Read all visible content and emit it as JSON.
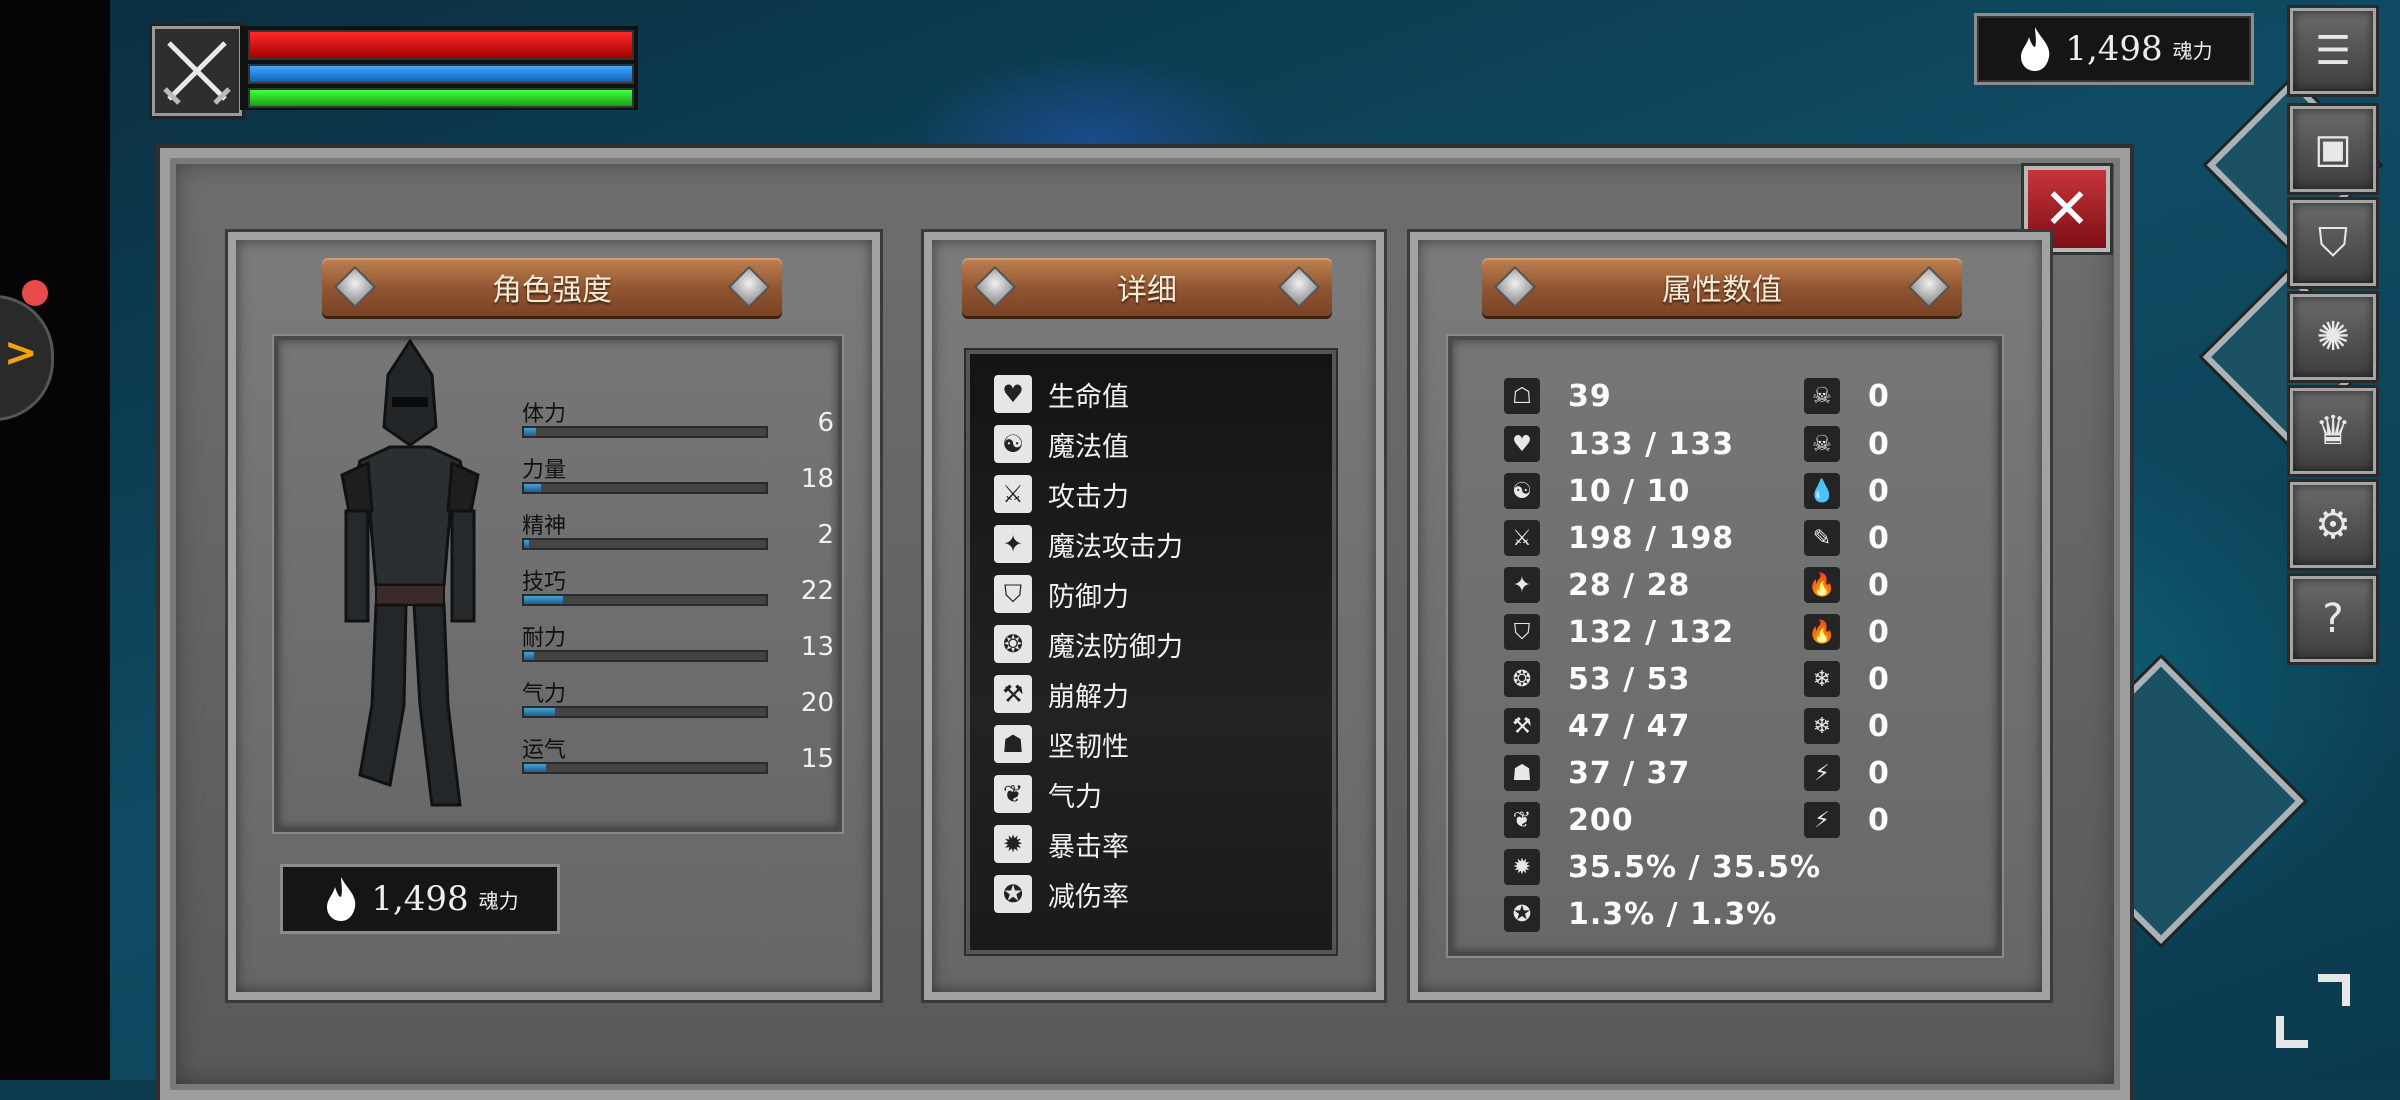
{
  "hud": {
    "soul_power": {
      "value": "1,498",
      "unit": "魂力"
    }
  },
  "menu_buttons": [
    {
      "name": "menu-list-button",
      "glyph": "☰"
    },
    {
      "name": "inventory-button",
      "glyph": "▣"
    },
    {
      "name": "armor-button",
      "glyph": "⛉"
    },
    {
      "name": "skill-button",
      "glyph": "✺"
    },
    {
      "name": "crown-button",
      "glyph": "♛"
    },
    {
      "name": "settings-button",
      "glyph": "⚙"
    },
    {
      "name": "help-button",
      "glyph": "?"
    }
  ],
  "panels": {
    "character": {
      "title": "角色强度",
      "stats": [
        {
          "label": "体力",
          "value": "6",
          "fill": 0.05
        },
        {
          "label": "力量",
          "value": "18",
          "fill": 0.07
        },
        {
          "label": "精神",
          "value": "2",
          "fill": 0.02
        },
        {
          "label": "技巧",
          "value": "22",
          "fill": 0.16
        },
        {
          "label": "耐力",
          "value": "13",
          "fill": 0.04
        },
        {
          "label": "气力",
          "value": "20",
          "fill": 0.13
        },
        {
          "label": "运气",
          "value": "15",
          "fill": 0.09
        }
      ],
      "soul_power": {
        "value": "1,498",
        "unit": "魂力"
      }
    },
    "detail": {
      "title": "详细",
      "rows": [
        {
          "icon": "♥",
          "icon_name": "heart-icon",
          "label": "生命值"
        },
        {
          "icon": "☯",
          "icon_name": "mind-icon",
          "label": "魔法值"
        },
        {
          "icon": "⚔",
          "icon_name": "sword-icon",
          "label": "攻击力"
        },
        {
          "icon": "✦",
          "icon_name": "spellbook-icon",
          "label": "魔法攻击力"
        },
        {
          "icon": "⛉",
          "icon_name": "shield-icon",
          "label": "防御力"
        },
        {
          "icon": "❂",
          "icon_name": "magic-shield-icon",
          "label": "魔法防御力"
        },
        {
          "icon": "⚒",
          "icon_name": "hammer-icon",
          "label": "崩解力"
        },
        {
          "icon": "☗",
          "icon_name": "helmet-icon",
          "label": "坚韧性"
        },
        {
          "icon": "❦",
          "icon_name": "lungs-icon",
          "label": "气力"
        },
        {
          "icon": "✹",
          "icon_name": "critical-icon",
          "label": "暴击率"
        },
        {
          "icon": "✪",
          "icon_name": "damage-reduction-icon",
          "label": "减伤率"
        }
      ]
    },
    "attributes": {
      "title": "属性数值",
      "left": [
        {
          "icon": "☖",
          "icon_name": "armor-weight-icon",
          "value": "39"
        },
        {
          "icon": "♥",
          "icon_name": "heart-icon",
          "value": "133 / 133"
        },
        {
          "icon": "☯",
          "icon_name": "mind-icon",
          "value": "10 / 10"
        },
        {
          "icon": "⚔",
          "icon_name": "sword-icon",
          "value": "198 / 198"
        },
        {
          "icon": "✦",
          "icon_name": "spellbook-icon",
          "value": "28 / 28"
        },
        {
          "icon": "⛉",
          "icon_name": "shield-icon",
          "value": "132 / 132"
        },
        {
          "icon": "❂",
          "icon_name": "magic-shield-icon",
          "value": "53 / 53"
        },
        {
          "icon": "⚒",
          "icon_name": "hammer-icon",
          "value": "47 / 47"
        },
        {
          "icon": "☗",
          "icon_name": "helmet-icon",
          "value": "37 / 37"
        },
        {
          "icon": "❦",
          "icon_name": "lungs-icon",
          "value": "200"
        },
        {
          "icon": "✹",
          "icon_name": "critical-icon",
          "value": "35.5% / 35.5%"
        },
        {
          "icon": "✪",
          "icon_name": "damage-reduction-icon",
          "value": "1.3% / 1.3%"
        }
      ],
      "right": [
        {
          "icon": "☠",
          "icon_name": "poison-icon",
          "value": "0"
        },
        {
          "icon": "☠",
          "icon_name": "poison-resist-icon",
          "value": "0"
        },
        {
          "icon": "💧",
          "icon_name": "bleed-icon",
          "value": "0"
        },
        {
          "icon": "✎",
          "icon_name": "bleed-resist-icon",
          "value": "0"
        },
        {
          "icon": "🔥",
          "icon_name": "fire-icon",
          "value": "0"
        },
        {
          "icon": "🔥",
          "icon_name": "fire-resist-icon",
          "value": "0"
        },
        {
          "icon": "❄",
          "icon_name": "frost-icon",
          "value": "0"
        },
        {
          "icon": "❄",
          "icon_name": "frost-resist-icon",
          "value": "0"
        },
        {
          "icon": "⚡",
          "icon_name": "lightning-icon",
          "value": "0"
        },
        {
          "icon": "⚡",
          "icon_name": "lightning-resist-icon",
          "value": "0"
        }
      ]
    }
  },
  "colors": {
    "health": "#d81818",
    "mana": "#2b8bd8",
    "stamina": "#26c926",
    "close": "#b3242b"
  }
}
